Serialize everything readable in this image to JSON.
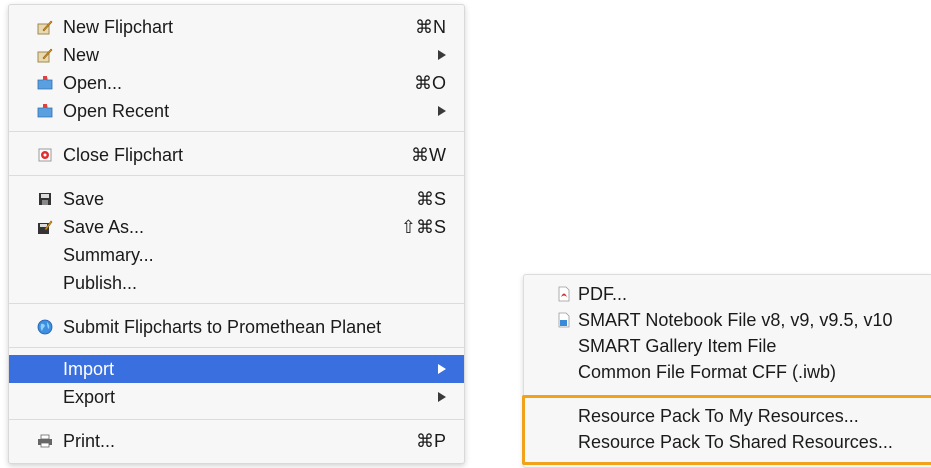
{
  "file_menu": {
    "items": [
      {
        "label": "New Flipchart",
        "shortcut": "⌘N",
        "icon": "flipchart-pen-icon"
      },
      {
        "label": "New",
        "icon": "flipchart-pen-icon"
      },
      {
        "label": "Open...",
        "shortcut": "⌘O",
        "icon": "folder-icon"
      },
      {
        "label": "Open Recent",
        "icon": "folder-icon"
      },
      {
        "label": "Close Flipchart",
        "shortcut": "⌘W",
        "icon": "close-flipchart-icon"
      },
      {
        "label": "Save",
        "shortcut": "⌘S",
        "icon": "floppy-disk-icon"
      },
      {
        "label": "Save As...",
        "shortcut": "⇧⌘S",
        "icon": "save-as-icon"
      },
      {
        "label": "Summary..."
      },
      {
        "label": "Publish..."
      },
      {
        "label": "Submit Flipcharts to Promethean Planet",
        "icon": "globe-icon"
      },
      {
        "label": "Import"
      },
      {
        "label": "Export"
      },
      {
        "label": "Print...",
        "shortcut": "⌘P",
        "icon": "printer-icon"
      }
    ]
  },
  "import_submenu": {
    "items": [
      {
        "label": "PDF...",
        "icon": "pdf-icon"
      },
      {
        "label": "SMART Notebook File v8, v9, v9.5, v10",
        "icon": "document-icon"
      },
      {
        "label": "SMART Gallery Item File"
      },
      {
        "label": "Common File Format CFF (.iwb)"
      },
      {
        "label": "Resource Pack To My Resources..."
      },
      {
        "label": "Resource Pack To Shared Resources..."
      }
    ]
  },
  "colors": {
    "highlight": "#3a6fe0",
    "annotation_box": "#f0a21a",
    "menu_background": "#f7f7f7"
  }
}
